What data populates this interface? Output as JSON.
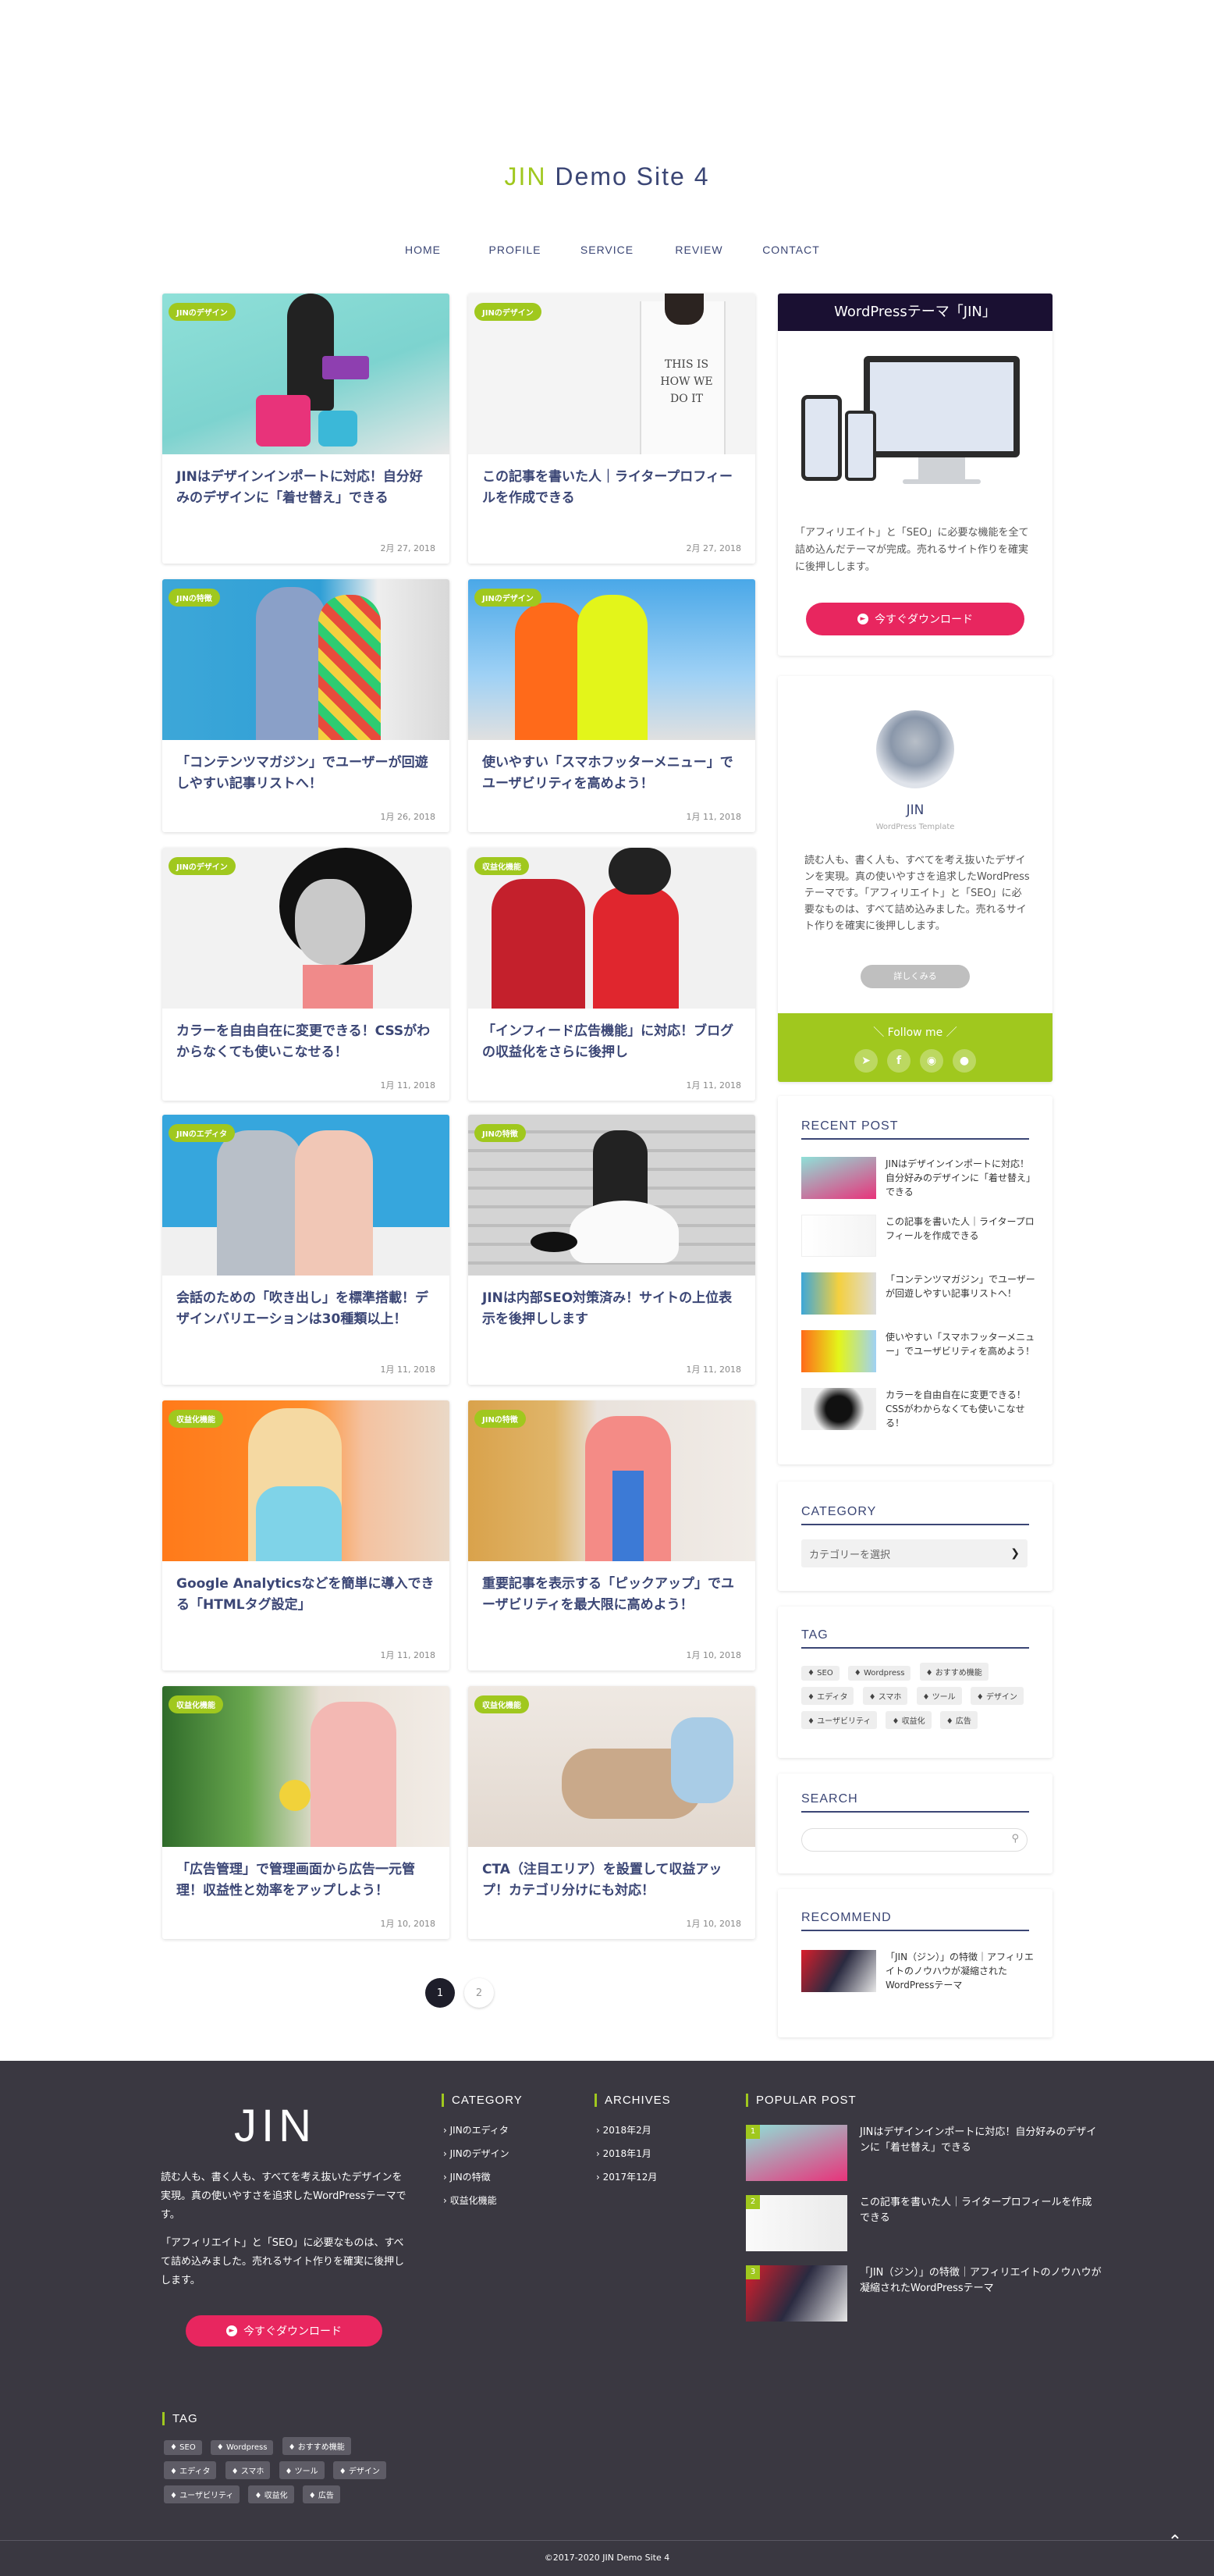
{
  "site": {
    "title_accent": "JIN",
    "title_rest": " Demo Site 4"
  },
  "nav": [
    "HOME",
    "PROFILE",
    "SERVICE",
    "REVIEW",
    "CONTACT"
  ],
  "cards": [
    {
      "cat": "JINのデザイン",
      "title": "JINはデザインインポートに対応！自分好みのデザインに「着せ替え」できる",
      "date": "2月 27, 2018"
    },
    {
      "cat": "JINのデザイン",
      "title": "この記事を書いた人｜ライタープロフィールを作成できる",
      "date": "2月 27, 2018"
    },
    {
      "cat": "JINの特徴",
      "title": "「コンテンツマガジン」でユーザーが回遊しやすい記事リストへ！",
      "date": "1月 26, 2018"
    },
    {
      "cat": "JINのデザイン",
      "title": "使いやすい「スマホフッターメニュー」でユーザビリティを高めよう！",
      "date": "1月 11, 2018"
    },
    {
      "cat": "JINのデザイン",
      "title": "カラーを自由自在に変更できる！CSSがわからなくても使いこなせる！",
      "date": "1月 11, 2018"
    },
    {
      "cat": "収益化機能",
      "title": "「インフィード広告機能」に対応！ブログの収益化をさらに後押し",
      "date": "1月 11, 2018"
    },
    {
      "cat": "JINのエディタ",
      "title": "会話のための「吹き出し」を標準搭載！デザインバリエーションは30種類以上！",
      "date": "1月 11, 2018"
    },
    {
      "cat": "JINの特徴",
      "title": "JINは内部SEO対策済み！サイトの上位表示を後押しします",
      "date": "1月 11, 2018"
    },
    {
      "cat": "収益化機能",
      "title": "Google Analyticsなどを簡単に導入できる「HTMLタグ設定」",
      "date": "1月 11, 2018"
    },
    {
      "cat": "JINの特徴",
      "title": "重要記事を表示する「ピックアップ」でユーザビリティを最大限に高めよう！",
      "date": "1月 10, 2018"
    },
    {
      "cat": "収益化機能",
      "title": "「広告管理」で管理画面から広告一元管理！収益性と効率をアップしよう！",
      "date": "1月 10, 2018"
    },
    {
      "cat": "収益化機能",
      "title": "CTA（注目エリア）を設置して収益アップ！カテゴリ分けにも対応！",
      "date": "1月 10, 2018"
    }
  ],
  "pager": [
    "1",
    "2"
  ],
  "sidebar": {
    "promo": {
      "header": "WordPressテーマ「JIN」",
      "text": "「アフィリエイト」と「SEO」に必要な機能を全て詰め込んだテーマが完成。売れるサイト作りを確実に後押しします。",
      "button": "今すぐダウンロード"
    },
    "profile": {
      "name": "JIN",
      "sub": "WordPress Template",
      "text": "読む人も、書く人も、すべてを考え抜いたデザインを実現。真の使いやすさを追求したWordPressテーマです。「アフィリエイト」と「SEO」に必要なものは、すべて詰め込みました。売れるサイト作りを確実に後押しします。",
      "more": "詳しくみる",
      "follow": "＼ Follow me ／"
    },
    "recent_title": "RECENT POST",
    "recent": [
      "JINはデザインインポートに対応！自分好みのデザインに「着せ替え」できる",
      "この記事を書いた人｜ライタープロフィールを作成できる",
      "「コンテンツマガジン」でユーザーが回遊しやすい記事リストへ！",
      "使いやすい「スマホフッターメニュー」でユーザビリティを高めよう！",
      "カラーを自由自在に変更できる！CSSがわからなくても使いこなせる！"
    ],
    "category_title": "CATEGORY",
    "category_placeholder": "カテゴリーを選択",
    "tag_title": "TAG",
    "tags": [
      "SEO",
      "Wordpress",
      "おすすめ機能",
      "エディタ",
      "スマホ",
      "ツール",
      "デザイン",
      "ユーザビリティ",
      "収益化",
      "広告"
    ],
    "search_title": "SEARCH",
    "recommend_title": "RECOMMEND",
    "recommend": "「JIN（ジン）」の特徴｜アフィリエイトのノウハウが凝縮されたWordPressテーマ"
  },
  "footer": {
    "logo": "JIN",
    "text1": "読む人も、書く人も、すべてを考え抜いたデザインを実現。真の使いやすさを追求したWordPressテーマです。",
    "text2": "「アフィリエイト」と「SEO」に必要なものは、すべて詰め込みました。売れるサイト作りを確実に後押しします。",
    "button": "今すぐダウンロード",
    "category_title": "CATEGORY",
    "categories": [
      "JINのエディタ",
      "JINのデザイン",
      "JINの特徴",
      "収益化機能"
    ],
    "archives_title": "ARCHIVES",
    "archives": [
      "2018年2月",
      "2018年1月",
      "2017年12月"
    ],
    "popular_title": "POPULAR POST",
    "popular": [
      {
        "rank": "1",
        "title": "JINはデザインインポートに対応！自分好みのデザインに「着せ替え」できる"
      },
      {
        "rank": "2",
        "title": "この記事を書いた人｜ライタープロフィールを作成できる"
      },
      {
        "rank": "3",
        "title": "「JIN（ジン）」の特徴｜アフィリエイトのノウハウが凝縮されたWordPressテーマ"
      }
    ],
    "tag_title": "TAG",
    "tags": [
      "SEO",
      "Wordpress",
      "おすすめ機能",
      "エディタ",
      "スマホ",
      "ツール",
      "デザイン",
      "ユーザビリティ",
      "収益化",
      "広告"
    ],
    "copyright": "©2017-2020  JIN Demo Site 4"
  },
  "colors": {
    "accent": "#a0c81e",
    "dark": "#3b4675",
    "pink": "#e8265f",
    "footer_bg": "#3a3841"
  }
}
